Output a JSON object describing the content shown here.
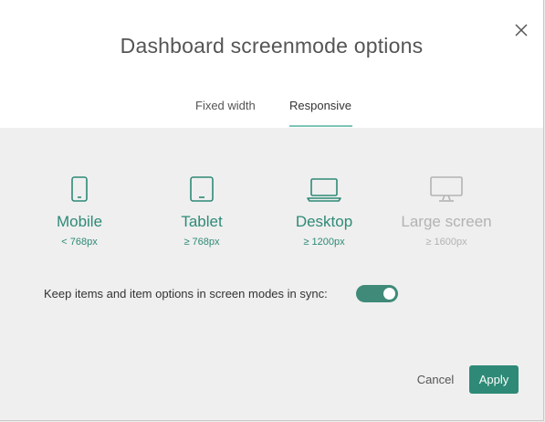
{
  "dialog": {
    "title": "Dashboard screenmode options"
  },
  "tabs": [
    {
      "label": "Fixed width",
      "selected": false
    },
    {
      "label": "Responsive",
      "selected": true
    }
  ],
  "modes": [
    {
      "label": "Mobile",
      "size": "< 768px",
      "icon": "mobile-phone-icon",
      "state": "active"
    },
    {
      "label": "Tablet",
      "size": "≥ 768px",
      "icon": "tablet-icon",
      "state": "active"
    },
    {
      "label": "Desktop",
      "size": "≥ 1200px",
      "icon": "laptop-icon",
      "state": "active"
    },
    {
      "label": "Large screen",
      "size": "≥ 1600px",
      "icon": "monitor-icon",
      "state": "disabled"
    }
  ],
  "sync": {
    "label": "Keep items and item options in screen modes in sync:",
    "enabled": true
  },
  "footer": {
    "cancel_label": "Cancel",
    "apply_label": "Apply"
  },
  "colors": {
    "accent": "#2e8a76",
    "toggle": "#3f8a78",
    "disabled": "#b3b3b3",
    "underline": "#7ec5b6"
  }
}
